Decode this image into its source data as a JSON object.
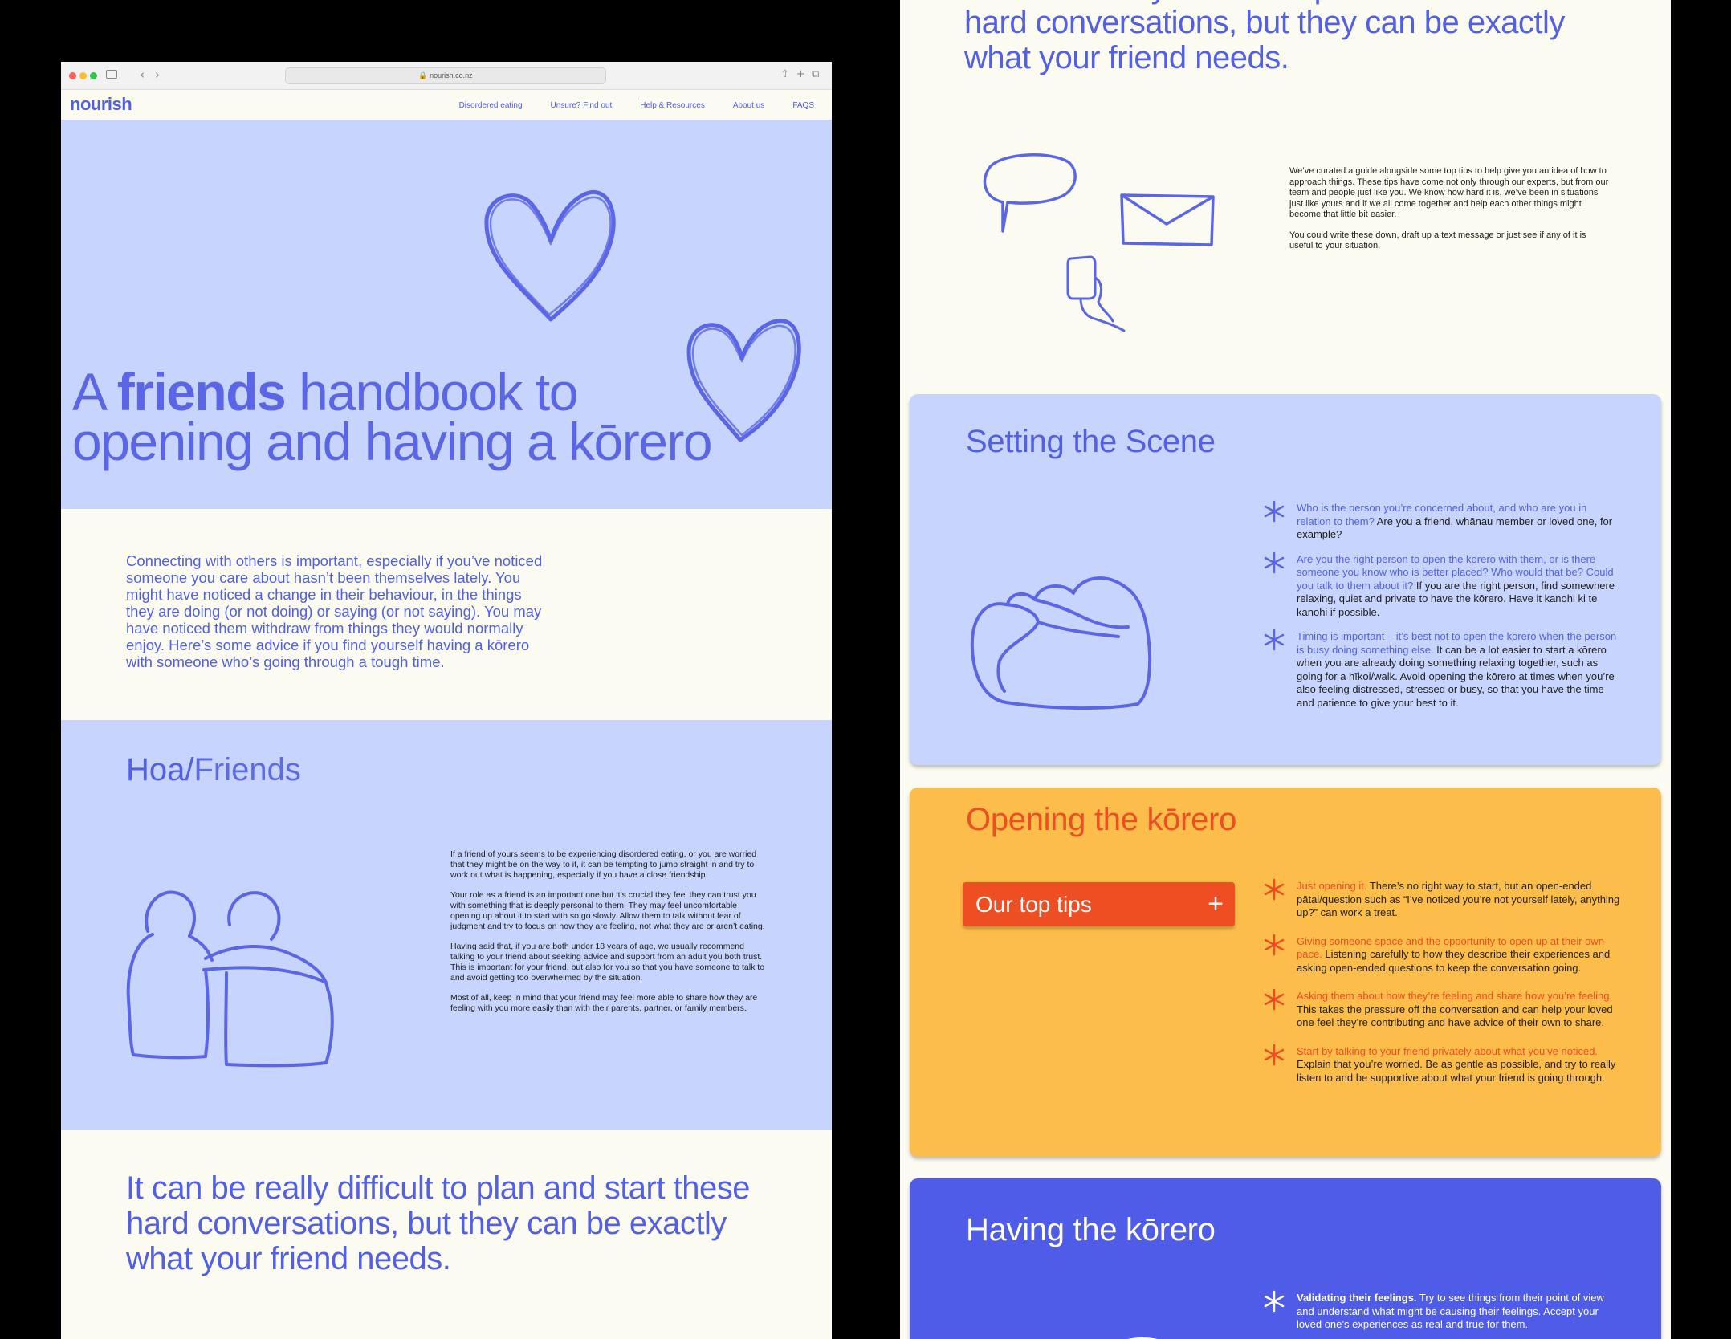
{
  "browser": {
    "url": "nourish.co.nz",
    "nav_back": "‹",
    "nav_forward": "›",
    "toolbar_share": "⇧",
    "toolbar_new_tab": "+",
    "toolbar_tabs": "⧉"
  },
  "site": {
    "logo": "nourish",
    "nav": [
      "Disordered eating",
      "Unsure? Find out",
      "Help & Resources",
      "About us",
      "FAQS"
    ]
  },
  "hero": {
    "title_pre": "A ",
    "title_bold": "friends",
    "title_post": " handbook to",
    "title_line2": "opening and having a kōrero"
  },
  "intro": {
    "text": "Connecting with others is important, especially if you’ve noticed someone you care about hasn’t been themselves lately. You might have noticed a change in their behaviour, in the things they are doing (or not doing) or saying (or not saying). You may have noticed them withdraw from things they would normally enjoy. Here’s some advice if you find yourself having a kōrero with someone who’s going through a tough time."
  },
  "friends": {
    "heading_a": "Hoa/",
    "heading_b": "Friends",
    "paragraphs": [
      "If a friend of yours seems to be experiencing disordered eating, or you are worried that they might be on the way to it, it can be tempting to jump straight in and try to work out what is happening, especially if you have a close friendship.",
      "Your role as a friend is an important one but it’s crucial they feel they can trust you with something that is deeply personal to them. They may feel uncomfortable opening up about it to start with so go slowly. Allow them to talk without fear of judgment and try to focus on how they are feeling, not what they are or aren’t eating.",
      "Having said that, if you are both under 18 years of age, we usually recommend talking to your friend about seeking advice and support from an adult you both trust. This is important for your friend, but also for you so that you have someone to talk to and avoid getting too overwhelmed by the situation.",
      "Most of all, keep in mind that your friend may feel more able to share how they are feeling with you more easily than with their parents, partner, or family members."
    ]
  },
  "closing": {
    "text": "It can be really difficult to plan and start these hard conversations, but they can be exactly what your friend needs."
  },
  "panel": {
    "top_quote": "It can be really difficult to plan and start these hard conversations, but they can be exactly what your friend needs.",
    "curated": [
      "We’ve curated a guide alongside some top tips to help give you an idea of how to approach things. These tips have come not only through our experts, but from our team and people just like you. We know how hard it is, we’ve been in situations just like yours and if we all come together and help each other things might become that little bit easier.",
      "You could write these down, draft up a text message or just see if any of it is useful to your situation."
    ]
  },
  "scene": {
    "heading": "Setting the Scene",
    "tips": [
      {
        "hl": "Who is the person you’re concerned about, and who are you in relation to them?",
        "text": " Are you a friend, whānau member or loved one, for example?"
      },
      {
        "hl": "Are you the right person to open the kōrero with them, or is there someone you know who is better placed? Who would that be? Could you talk to them about it?",
        "text": " If you are the right person, find somewhere relaxing, quiet and private to have the kōrero. Have it kanohi ki te kanohi if possible."
      },
      {
        "hl": "Timing is important – it’s best not to open the kōrero when the person is busy doing something else.",
        "text": " It can be a lot easier to start a kōrero when you are already doing something relaxing together, such as going for a hīkoi/walk. Avoid opening the kōrero at times when you’re also feeling distressed, stressed or busy, so that you have the time and patience to give your best to it."
      }
    ]
  },
  "opening": {
    "heading": "Opening the kōrero",
    "button": "Our top tips",
    "button_icon": "+",
    "tips": [
      {
        "hl": "Just opening it.",
        "text": " There’s no right way to start, but an open-ended pātai/question such as “I’ve noticed you’re not yourself lately, anything up?” can work a treat."
      },
      {
        "hl": "Giving someone space and the opportunity to open up at their own pace.",
        "text": " Listening carefully to how they describe their experiences and asking open-ended questions to keep the conversation going."
      },
      {
        "hl": "Asking them about how they’re feeling and share how you’re feeling.",
        "text": " This takes the pressure off the conversation and can help your loved one feel they’re contributing and have advice of their own to share."
      },
      {
        "hl": "Start by talking to your friend privately about what you’ve noticed.",
        "text": " Explain that you’re worried. Be as gentle as possible, and try to really listen to and be supportive about what your friend is going through."
      }
    ]
  },
  "having": {
    "heading": "Having the kōrero",
    "tips": [
      {
        "hl": "Validating their feelings.",
        "text": " Try to see things from their point of view and understand what might be causing their feelings. Accept your loved one’s experiences as real and true for them."
      }
    ]
  },
  "colors": {
    "brand_blue": "#5360e5",
    "lavender": "#c7d4fd",
    "cream": "#fbfbf2",
    "orange": "#ee4e22",
    "amber": "#fdbd4b",
    "royal": "#4f5ce7"
  },
  "icons": [
    "heart-icon",
    "speech-bubble-icon",
    "envelope-icon",
    "phone-hand-icon",
    "hug-icon",
    "friends-hug-icon",
    "asterisk-icon",
    "plus-icon"
  ]
}
